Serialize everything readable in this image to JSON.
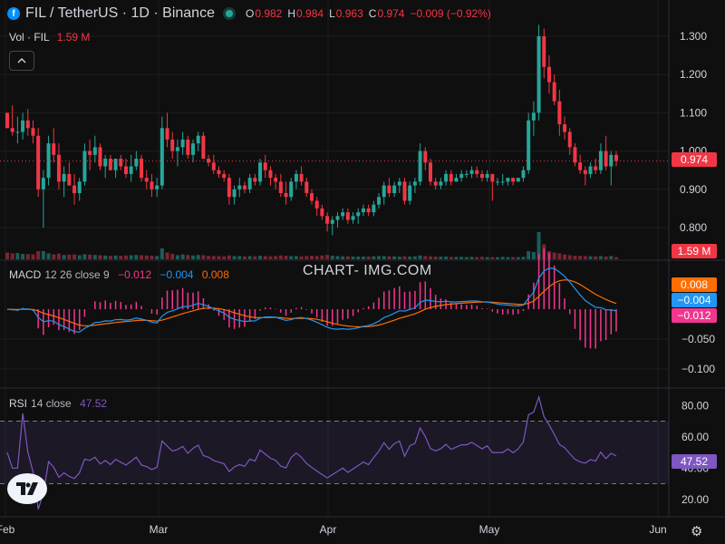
{
  "header": {
    "coin_glyph": "f",
    "title": "FIL / TetherUS · 1D · Binance",
    "ohlc": {
      "o_label": "O",
      "o": "0.982",
      "h_label": "H",
      "h": "0.984",
      "l_label": "L",
      "l": "0.963",
      "c_label": "C",
      "c": "0.974",
      "change": "−0.009 (−0.92%)"
    }
  },
  "volume_legend": {
    "label": "Vol · FIL",
    "value": "1.59 M"
  },
  "collapse_icon": "^",
  "watermark": "CHART- IMG.COM",
  "macd_legend": {
    "name": "MACD",
    "params": "12 26 close 9",
    "v1": "−0.012",
    "v2": "−0.004",
    "v3": "0.008"
  },
  "rsi_legend": {
    "name": "RSI",
    "params": "14 close",
    "value": "47.52"
  },
  "tags": {
    "price": "0.974",
    "volume": "1.59 M",
    "macd_signal": "0.008",
    "macd_line": "−0.004",
    "macd_hist": "−0.012",
    "rsi": "47.52"
  },
  "colors": {
    "up": "#26a69a",
    "down": "#f23645",
    "macd": "#2196f3",
    "signal": "#ff6d00",
    "rsi": "#7e57c2",
    "hist": "#f23690",
    "background": "#0f0f0f",
    "grid": "#1e1e1e"
  },
  "chart_data": {
    "type": "candlestick",
    "price_axis": {
      "ticks": [
        "1.300",
        "1.200",
        "1.100",
        "1.000",
        "0.900",
        "0.800"
      ],
      "ylim": [
        0.74,
        1.34
      ]
    },
    "x_axis": {
      "ticks": [
        "Feb",
        "Mar",
        "Apr",
        "May",
        "Jun"
      ]
    },
    "candles_ohlc": [
      [
        1.1,
        1.1,
        1.06,
        1.06
      ],
      [
        1.06,
        1.12,
        1.04,
        1.05
      ],
      [
        1.05,
        1.09,
        1.02,
        1.05
      ],
      [
        1.05,
        1.1,
        1.03,
        1.08
      ],
      [
        1.08,
        1.11,
        1.04,
        1.06
      ],
      [
        1.06,
        1.08,
        1.02,
        1.04
      ],
      [
        1.04,
        1.06,
        0.88,
        0.9
      ],
      [
        0.9,
        0.95,
        0.8,
        0.93
      ],
      [
        0.93,
        1.04,
        0.91,
        1.02
      ],
      [
        1.02,
        1.06,
        0.97,
        0.99
      ],
      [
        0.99,
        1.02,
        0.9,
        0.92
      ],
      [
        0.92,
        0.96,
        0.88,
        0.94
      ],
      [
        0.94,
        0.97,
        0.91,
        0.91
      ],
      [
        0.91,
        0.94,
        0.86,
        0.89
      ],
      [
        0.89,
        0.93,
        0.87,
        0.92
      ],
      [
        0.92,
        1.02,
        0.91,
        1.0
      ],
      [
        1.0,
        1.03,
        0.95,
        0.99
      ],
      [
        0.99,
        1.04,
        0.97,
        1.01
      ],
      [
        1.01,
        1.02,
        0.95,
        0.96
      ],
      [
        0.96,
        0.99,
        0.93,
        0.98
      ],
      [
        0.98,
        0.99,
        0.95,
        0.95
      ],
      [
        0.95,
        0.98,
        0.93,
        0.98
      ],
      [
        0.98,
        0.99,
        0.95,
        0.96
      ],
      [
        0.96,
        0.98,
        0.93,
        0.94
      ],
      [
        0.94,
        0.99,
        0.92,
        0.96
      ],
      [
        0.96,
        1.0,
        0.95,
        0.98
      ],
      [
        0.98,
        0.99,
        0.92,
        0.93
      ],
      [
        0.93,
        0.95,
        0.9,
        0.92
      ],
      [
        0.92,
        0.94,
        0.88,
        0.9
      ],
      [
        0.9,
        0.93,
        0.88,
        0.91
      ],
      [
        0.91,
        1.09,
        0.9,
        1.06
      ],
      [
        1.06,
        1.1,
        1.01,
        1.03
      ],
      [
        1.03,
        1.05,
        0.98,
        1.0
      ],
      [
        1.0,
        1.03,
        0.96,
        1.01
      ],
      [
        1.01,
        1.05,
        0.99,
        1.03
      ],
      [
        1.03,
        1.04,
        0.98,
        0.99
      ],
      [
        0.99,
        1.03,
        0.97,
        1.02
      ],
      [
        1.02,
        1.05,
        1.0,
        1.04
      ],
      [
        1.04,
        1.05,
        0.98,
        0.98
      ],
      [
        0.98,
        0.99,
        0.96,
        0.97
      ],
      [
        0.97,
        0.99,
        0.94,
        0.95
      ],
      [
        0.95,
        0.96,
        0.93,
        0.94
      ],
      [
        0.94,
        0.95,
        0.92,
        0.93
      ],
      [
        0.93,
        0.94,
        0.86,
        0.88
      ],
      [
        0.88,
        0.91,
        0.86,
        0.9
      ],
      [
        0.9,
        0.93,
        0.88,
        0.91
      ],
      [
        0.91,
        0.92,
        0.89,
        0.9
      ],
      [
        0.9,
        0.94,
        0.89,
        0.93
      ],
      [
        0.93,
        0.94,
        0.91,
        0.92
      ],
      [
        0.92,
        0.98,
        0.91,
        0.97
      ],
      [
        0.97,
        0.99,
        0.93,
        0.95
      ],
      [
        0.95,
        0.96,
        0.91,
        0.93
      ],
      [
        0.93,
        0.94,
        0.9,
        0.92
      ],
      [
        0.92,
        0.94,
        0.88,
        0.89
      ],
      [
        0.89,
        0.92,
        0.86,
        0.88
      ],
      [
        0.88,
        0.93,
        0.87,
        0.92
      ],
      [
        0.92,
        0.95,
        0.9,
        0.94
      ],
      [
        0.94,
        0.96,
        0.91,
        0.92
      ],
      [
        0.92,
        0.93,
        0.88,
        0.89
      ],
      [
        0.89,
        0.9,
        0.86,
        0.87
      ],
      [
        0.87,
        0.88,
        0.83,
        0.85
      ],
      [
        0.85,
        0.86,
        0.82,
        0.83
      ],
      [
        0.83,
        0.84,
        0.79,
        0.81
      ],
      [
        0.81,
        0.83,
        0.78,
        0.82
      ],
      [
        0.82,
        0.84,
        0.8,
        0.83
      ],
      [
        0.83,
        0.85,
        0.82,
        0.84
      ],
      [
        0.84,
        0.85,
        0.81,
        0.82
      ],
      [
        0.82,
        0.84,
        0.81,
        0.83
      ],
      [
        0.83,
        0.85,
        0.81,
        0.84
      ],
      [
        0.84,
        0.86,
        0.83,
        0.85
      ],
      [
        0.85,
        0.86,
        0.83,
        0.84
      ],
      [
        0.84,
        0.87,
        0.83,
        0.86
      ],
      [
        0.86,
        0.89,
        0.85,
        0.88
      ],
      [
        0.88,
        0.92,
        0.86,
        0.91
      ],
      [
        0.91,
        0.93,
        0.88,
        0.89
      ],
      [
        0.89,
        0.92,
        0.88,
        0.91
      ],
      [
        0.91,
        0.93,
        0.89,
        0.92
      ],
      [
        0.92,
        0.93,
        0.86,
        0.87
      ],
      [
        0.87,
        0.92,
        0.86,
        0.91
      ],
      [
        0.91,
        0.93,
        0.89,
        0.92
      ],
      [
        0.92,
        1.02,
        0.91,
        1.0
      ],
      [
        1.0,
        1.01,
        0.95,
        0.97
      ],
      [
        0.97,
        0.98,
        0.91,
        0.92
      ],
      [
        0.92,
        0.93,
        0.9,
        0.91
      ],
      [
        0.91,
        0.93,
        0.9,
        0.92
      ],
      [
        0.92,
        0.95,
        0.91,
        0.94
      ],
      [
        0.94,
        0.95,
        0.91,
        0.92
      ],
      [
        0.92,
        0.94,
        0.92,
        0.93
      ],
      [
        0.93,
        0.95,
        0.92,
        0.94
      ],
      [
        0.94,
        0.95,
        0.93,
        0.94
      ],
      [
        0.94,
        0.96,
        0.93,
        0.95
      ],
      [
        0.95,
        0.96,
        0.93,
        0.94
      ],
      [
        0.94,
        0.95,
        0.92,
        0.93
      ],
      [
        0.93,
        0.95,
        0.92,
        0.94
      ],
      [
        0.94,
        0.94,
        0.87,
        0.92
      ],
      [
        0.92,
        0.93,
        0.91,
        0.92
      ],
      [
        0.92,
        0.94,
        0.91,
        0.92
      ],
      [
        0.92,
        0.93,
        0.91,
        0.93
      ],
      [
        0.93,
        0.93,
        0.91,
        0.92
      ],
      [
        0.92,
        0.93,
        0.92,
        0.93
      ],
      [
        0.93,
        0.96,
        0.92,
        0.95
      ],
      [
        0.95,
        1.1,
        0.94,
        1.08
      ],
      [
        1.08,
        1.13,
        1.04,
        1.1
      ],
      [
        1.1,
        1.33,
        1.08,
        1.3
      ],
      [
        1.3,
        1.32,
        1.19,
        1.22
      ],
      [
        1.22,
        1.25,
        1.15,
        1.18
      ],
      [
        1.18,
        1.2,
        1.12,
        1.13
      ],
      [
        1.13,
        1.16,
        1.04,
        1.07
      ],
      [
        1.07,
        1.09,
        1.03,
        1.05
      ],
      [
        1.05,
        1.06,
        0.99,
        1.01
      ],
      [
        1.01,
        1.02,
        0.96,
        0.97
      ],
      [
        0.97,
        0.99,
        0.94,
        0.95
      ],
      [
        0.95,
        0.96,
        0.91,
        0.94
      ],
      [
        0.94,
        0.97,
        0.93,
        0.96
      ],
      [
        0.96,
        0.98,
        0.94,
        0.95
      ],
      [
        0.95,
        1.02,
        0.94,
        1.0
      ],
      [
        1.0,
        1.04,
        0.95,
        0.96
      ],
      [
        0.96,
        1.0,
        0.91,
        0.99
      ],
      [
        0.99,
        1.0,
        0.96,
        0.974
      ]
    ],
    "volumes": [
      0.25,
      0.22,
      0.23,
      0.2,
      0.19,
      0.18,
      0.3,
      0.3,
      0.22,
      0.18,
      0.21,
      0.16,
      0.17,
      0.18,
      0.15,
      0.19,
      0.17,
      0.16,
      0.15,
      0.14,
      0.13,
      0.14,
      0.13,
      0.14,
      0.15,
      0.16,
      0.15,
      0.14,
      0.13,
      0.12,
      0.4,
      0.25,
      0.2,
      0.15,
      0.18,
      0.16,
      0.14,
      0.16,
      0.15,
      0.13,
      0.12,
      0.12,
      0.11,
      0.14,
      0.12,
      0.12,
      0.11,
      0.12,
      0.11,
      0.13,
      0.12,
      0.11,
      0.12,
      0.14,
      0.13,
      0.12,
      0.12,
      0.11,
      0.12,
      0.13,
      0.12,
      0.14,
      0.16,
      0.13,
      0.12,
      0.11,
      0.11,
      0.1,
      0.1,
      0.1,
      0.1,
      0.11,
      0.12,
      0.12,
      0.11,
      0.11,
      0.1,
      0.11,
      0.1,
      0.11,
      0.14,
      0.12,
      0.11,
      0.1,
      0.1,
      0.1,
      0.09,
      0.09,
      0.09,
      0.08,
      0.09,
      0.08,
      0.09,
      0.08,
      0.08,
      0.08,
      0.09,
      0.08,
      0.08,
      0.08,
      0.09,
      0.3,
      0.27,
      1.0,
      0.55,
      0.3,
      0.25,
      0.22,
      0.18,
      0.15,
      0.13,
      0.13,
      0.12,
      0.11,
      0.11,
      0.12,
      0.1,
      0.12,
      0.08
    ],
    "macd_axis": {
      "ticks": [
        "−0.050",
        "−0.100"
      ]
    },
    "rsi_axis": {
      "ticks": [
        "80.00",
        "60.00",
        "40.00",
        "20.00"
      ],
      "ylim": [
        10,
        90
      ],
      "bands": [
        30,
        70
      ]
    },
    "series": [
      {
        "name": "MACD",
        "values": []
      },
      {
        "name": "close",
        "values": []
      },
      {
        "name": "RSI",
        "values": []
      }
    ],
    "current": {
      "price": 0.974,
      "volume": "1.59 M",
      "macd": -0.004,
      "signal": 0.008,
      "histogram": -0.012,
      "rsi": 47.52
    }
  }
}
